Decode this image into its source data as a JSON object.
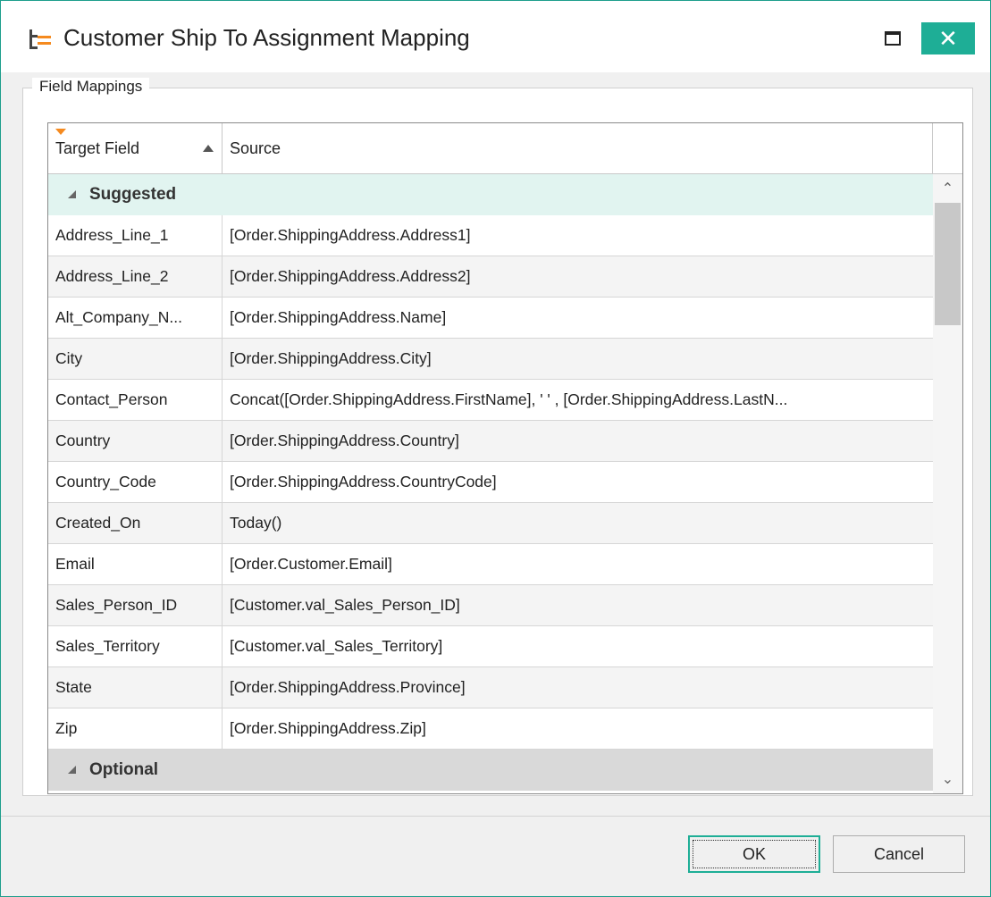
{
  "window": {
    "title": "Customer Ship To Assignment Mapping",
    "accent_color": "#1eae96",
    "close_glyph": "✕"
  },
  "group": {
    "legend": "Field Mappings"
  },
  "grid": {
    "columns": {
      "target": "Target Field",
      "source": "Source"
    },
    "groups": {
      "suggested": "Suggested",
      "optional": "Optional"
    },
    "rows": [
      {
        "target": "Address_Line_1",
        "source": "[Order.ShippingAddress.Address1]"
      },
      {
        "target": "Address_Line_2",
        "source": "[Order.ShippingAddress.Address2]"
      },
      {
        "target": "Alt_Company_N...",
        "source": "[Order.ShippingAddress.Name]"
      },
      {
        "target": "City",
        "source": "[Order.ShippingAddress.City]"
      },
      {
        "target": "Contact_Person",
        "source": "Concat([Order.ShippingAddress.FirstName], ' ' , [Order.ShippingAddress.LastN..."
      },
      {
        "target": "Country",
        "source": "[Order.ShippingAddress.Country]"
      },
      {
        "target": "Country_Code",
        "source": "[Order.ShippingAddress.CountryCode]"
      },
      {
        "target": "Created_On",
        "source": "Today()"
      },
      {
        "target": "Email",
        "source": "[Order.Customer.Email]"
      },
      {
        "target": "Sales_Person_ID",
        "source": "[Customer.val_Sales_Person_ID]"
      },
      {
        "target": "Sales_Territory",
        "source": "[Customer.val_Sales_Territory]"
      },
      {
        "target": "State",
        "source": "[Order.ShippingAddress.Province]"
      },
      {
        "target": "Zip",
        "source": "[Order.ShippingAddress.Zip]"
      }
    ]
  },
  "buttons": {
    "ok": "OK",
    "cancel": "Cancel"
  }
}
